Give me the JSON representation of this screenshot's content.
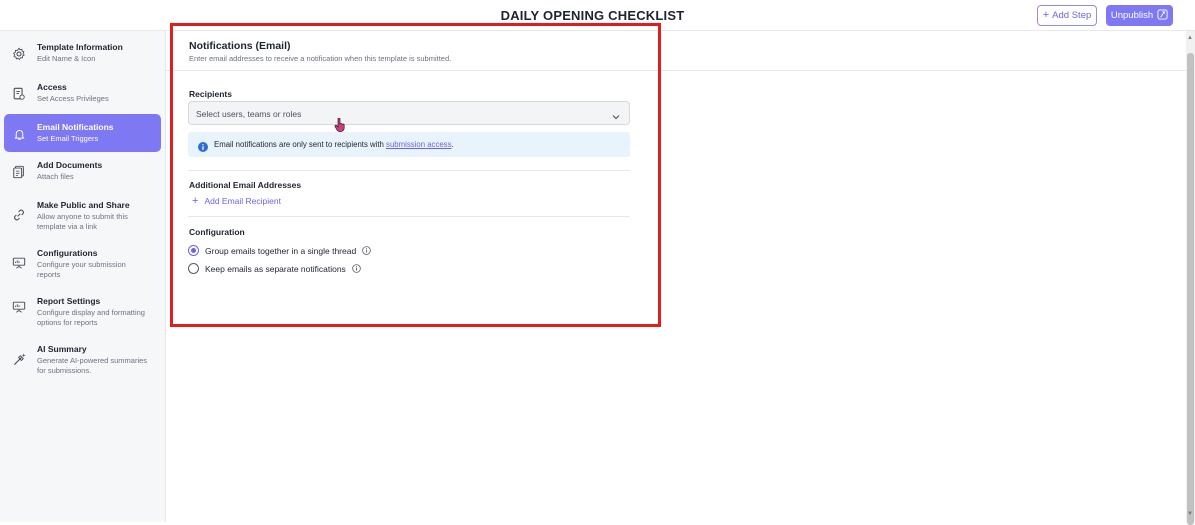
{
  "header": {
    "title": "DAILY OPENING CHECKLIST",
    "add_step_label": "Add Step",
    "unpublish_label": "Unpublish"
  },
  "sidebar": {
    "items": [
      {
        "label": "Template Information",
        "desc": "Edit Name & Icon",
        "icon": "gear-icon"
      },
      {
        "label": "Access",
        "desc": "Set Access Privileges",
        "icon": "access-document-icon"
      },
      {
        "label": "Email Notifications",
        "desc": "Set Email Triggers",
        "icon": "bell-icon",
        "active": true
      },
      {
        "label": "Add Documents",
        "desc": "Attach files",
        "icon": "documents-icon"
      },
      {
        "label": "Make Public and Share",
        "desc": "Allow anyone to submit this template via a link",
        "icon": "link-icon"
      },
      {
        "label": "Configurations",
        "desc": "Configure your submission reports",
        "icon": "presentation-icon"
      },
      {
        "label": "Report Settings",
        "desc": "Configure display and formatting options for reports",
        "icon": "report-icon"
      },
      {
        "label": "AI Summary",
        "desc": "Generate AI-powered summaries for submissions.",
        "icon": "ai-sparkle-icon"
      }
    ]
  },
  "panel": {
    "title": "Notifications (Email)",
    "subtitle": "Enter email addresses to receive a notification when this template is submitted.",
    "recipients_label": "Recipients",
    "recipients_placeholder": "Select users, teams or roles",
    "info_text": "Email notifications are only sent to recipients with ",
    "info_link": "submission access",
    "info_suffix": ".",
    "additional_label": "Additional Email Addresses",
    "add_recipient_label": "Add Email Recipient",
    "configuration_label": "Configuration",
    "options": [
      {
        "label": "Group emails together in a single thread",
        "checked": true
      },
      {
        "label": "Keep emails as separate notifications",
        "checked": false
      }
    ]
  },
  "colors": {
    "accent": "#7e79f3",
    "link": "#6c63e8",
    "highlight": "#e11d1d",
    "info_bg": "#e8f3fb"
  }
}
